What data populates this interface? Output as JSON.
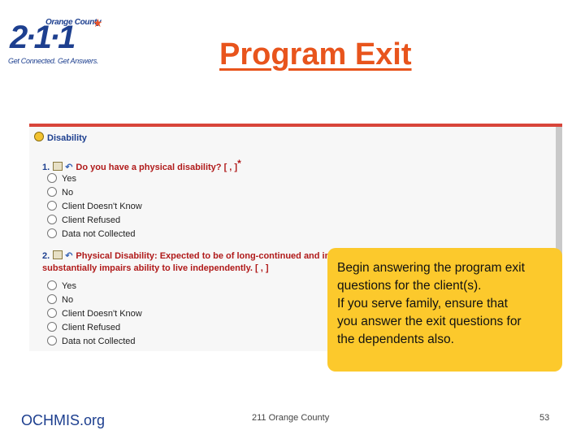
{
  "logo": {
    "top": "Orange County",
    "num": "2·1·1",
    "tagline": "Get Connected. Get Answers."
  },
  "title": "Program Exit",
  "screenshot": {
    "section": "Disability",
    "q1": {
      "num": "1.",
      "text": "Do you have a physical disability? [ , ]",
      "star": "*"
    },
    "q1_options": [
      "Yes",
      "No",
      "Client Doesn't Know",
      "Client Refused",
      "Data not Collected"
    ],
    "q2": {
      "num": "2.",
      "text": "Physical Disability: Expected to be of long-continued and indefinite duration and",
      "text2": "substantially impairs ability to live independently. [ , ]"
    },
    "q2_options": [
      "Yes",
      "No",
      "Client Doesn't Know",
      "Client Refused",
      "Data not Collected"
    ]
  },
  "callout": {
    "lines": [
      "Begin answering the program exit",
      "questions for the client(s).",
      "If you serve family, ensure that",
      "you answer the exit questions for",
      "the dependents also."
    ]
  },
  "footer": {
    "left": "OCHMIS.org",
    "mid": "211 Orange County",
    "page": "53"
  }
}
